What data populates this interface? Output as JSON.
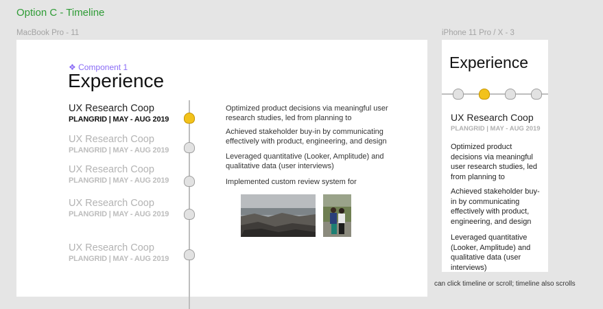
{
  "option_title": "Option C - Timeline",
  "desktop": {
    "frame_label": "MacBook Pro - 11",
    "component_label": "❖ Component 1",
    "heading": "Experience",
    "jobs": [
      {
        "title": "UX Research Coop",
        "subtitle": "PLANGRID | MAY - AUG 2019",
        "active": true
      },
      {
        "title": "UX Research Coop",
        "subtitle": "PLANGRID | MAY - AUG 2019",
        "active": false
      },
      {
        "title": "UX Research Coop",
        "subtitle": "PLANGRID | MAY - AUG 2019",
        "active": false
      },
      {
        "title": "UX Research Coop",
        "subtitle": "PLANGRID | MAY - AUG 2019",
        "active": false
      },
      {
        "title": "UX Research Coop",
        "subtitle": "PLANGRID | MAY - AUG 2019",
        "active": false
      }
    ],
    "bullets": [
      "Optimized product decisions via meaningful user research studies, led from planning to",
      "Achieved stakeholder buy-in by communicating effectively with product, engineering, and design",
      "Leveraged quantitative (Looker, Amplitude) and qualitative data  (user interviews)",
      "Implemented custom review system for"
    ]
  },
  "mobile": {
    "frame_label": "iPhone 11 Pro / X - 3",
    "heading": "Experience",
    "job_title": "UX Research Coop",
    "job_subtitle": "PLANGRID | MAY - AUG 2019",
    "bullets": [
      "Optimized product decisions via meaningful user research studies, led from planning to",
      "Achieved stakeholder buy-in by communicating effectively with product, engineering, and design",
      "Leveraged quantitative (Looker, Amplitude) and qualitative data  (user interviews)"
    ]
  },
  "note": "can click timeline or scroll; timeline also scrolls",
  "icons": {
    "timeline_marker": "duck-icon",
    "photos": [
      "coastline-photo",
      "people-photo"
    ]
  },
  "colors": {
    "accent_green": "#2e9b35",
    "component_purple": "#8a6cf6",
    "active_marker": "#f2c21b"
  }
}
